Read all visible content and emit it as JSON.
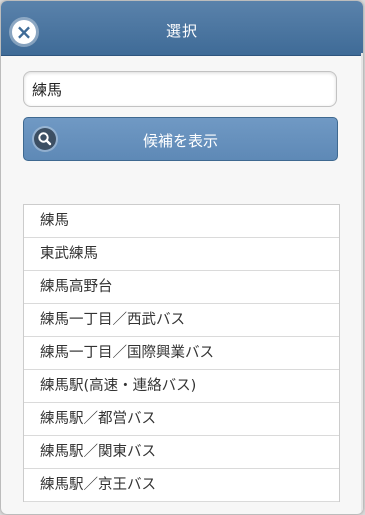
{
  "header": {
    "title": "選択",
    "close_icon": "close-icon"
  },
  "search": {
    "value": "練馬",
    "button_label": "候補を表示",
    "button_icon": "search-icon"
  },
  "results": [
    "練馬",
    "東武練馬",
    "練馬高野台",
    "練馬一丁目／西武バス",
    "練馬一丁目／国際興業バス",
    "練馬駅(高速・連絡バス)",
    "練馬駅／都営バス",
    "練馬駅／関東バス",
    "練馬駅／京王バス"
  ],
  "colors": {
    "header": "#4a74a0",
    "button": "#6790bd"
  }
}
